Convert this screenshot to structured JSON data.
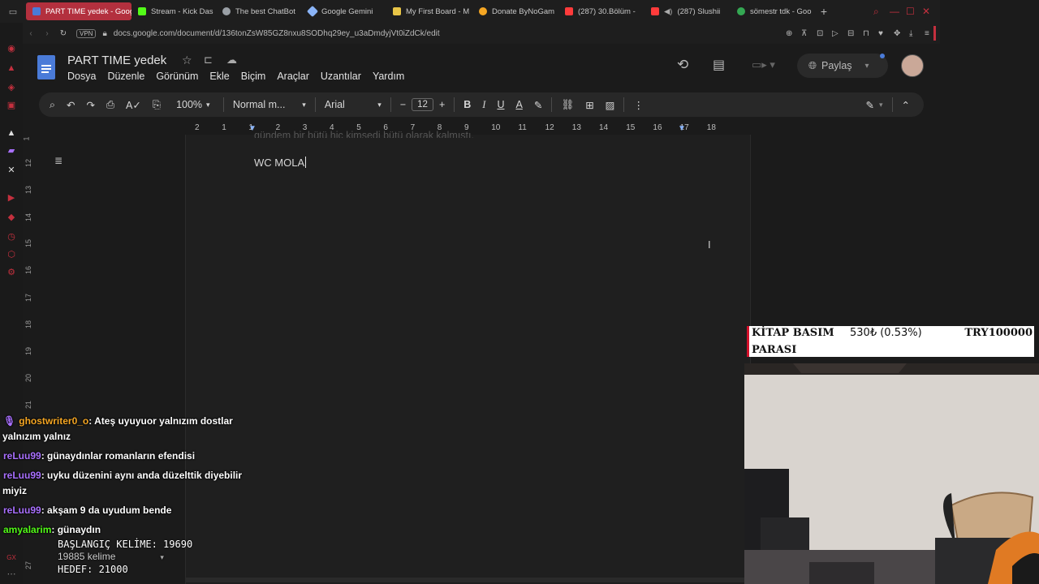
{
  "tabs": [
    {
      "label": "PART TIME yedek - Goog",
      "active": true,
      "color": "#4a7bd8"
    },
    {
      "label": "Stream - Kick Das",
      "active": false,
      "color": "#53fc18"
    },
    {
      "label": "The best ChatBot",
      "active": false,
      "color": "#9aa0a6"
    },
    {
      "label": "Google Gemini",
      "active": false,
      "color": "#8ab4f8"
    },
    {
      "label": "My First Board - M",
      "active": false,
      "color": "#e8c547"
    },
    {
      "label": "Donate ByNoGam",
      "active": false,
      "color": "#f5a623"
    },
    {
      "label": "(287) 30.Bölüm - ",
      "active": false,
      "color": "#ff3b3b"
    },
    {
      "label": "(287) Slushii",
      "active": false,
      "color": "#ff3b3b"
    },
    {
      "label": "sömestr tdk - Goo",
      "active": false,
      "color": "#34a853"
    }
  ],
  "address": {
    "badge": "VPN",
    "url": "docs.google.com/document/d/136tonZsW85GZ8nxu8SODhq29ey_u3aDmdyjVt0iZdCk/edit"
  },
  "doc": {
    "title": "PART TIME yedek",
    "menu": [
      "Dosya",
      "Düzenle",
      "Görünüm",
      "Ekle",
      "Biçim",
      "Araçlar",
      "Uzantılar",
      "Yardım"
    ],
    "share_label": "Paylaş",
    "body_text": "WC MOLA",
    "partial_line": "gündem bir bütü hiç kimsedi bütü olarak kalmıştı."
  },
  "toolbar": {
    "zoom": "100%",
    "style": "Normal m...",
    "font": "Arial",
    "font_size": "12"
  },
  "ruler": {
    "numbers": [
      "2",
      "1",
      "1",
      "2",
      "3",
      "4",
      "5",
      "6",
      "7",
      "8",
      "9",
      "10",
      "11",
      "12",
      "13",
      "14",
      "15",
      "16",
      "17",
      "18"
    ]
  },
  "vruler": {
    "numbers": [
      "1",
      "12",
      "13",
      "14",
      "15",
      "16",
      "17",
      "18",
      "19",
      "20",
      "21",
      "27"
    ]
  },
  "donation": {
    "line1": "KİTAP BASIM",
    "line2": "PARASI",
    "amount": "530₺ (0.53%)",
    "goal": "TRY100000",
    "accent": "#d4112b"
  },
  "chat": [
    {
      "user": "ghostwriter0_o",
      "color": "#f5a623",
      "text": ": Ateş uyuyuor yalnızım dostlar",
      "cont": "yalnızım yalnız",
      "badge": true
    },
    {
      "user": "reLuu99",
      "color": "#a970ff",
      "text": ": günaydınlar romanların efendisi",
      "cont": ""
    },
    {
      "user": "reLuu99",
      "color": "#a970ff",
      "text": ": uyku düzenini aynı anda düzelttik diyebilir",
      "cont": "miyiz"
    },
    {
      "user": "reLuu99",
      "color": "#a970ff",
      "text": ": akşam 9 da uyudum bende",
      "cont": ""
    },
    {
      "user": "amyalarim",
      "color": "#53fc18",
      "text": ": günaydın",
      "cont": ""
    }
  ],
  "counter": {
    "start": "BAŞLANGIÇ KELİME: 19690",
    "words": "19885 kelime",
    "goal": "HEDEF: 21000"
  },
  "colors": {
    "docs_blue": "#4a7bd8",
    "opera_red": "#c4303e",
    "active_tab": "#b3303e"
  }
}
